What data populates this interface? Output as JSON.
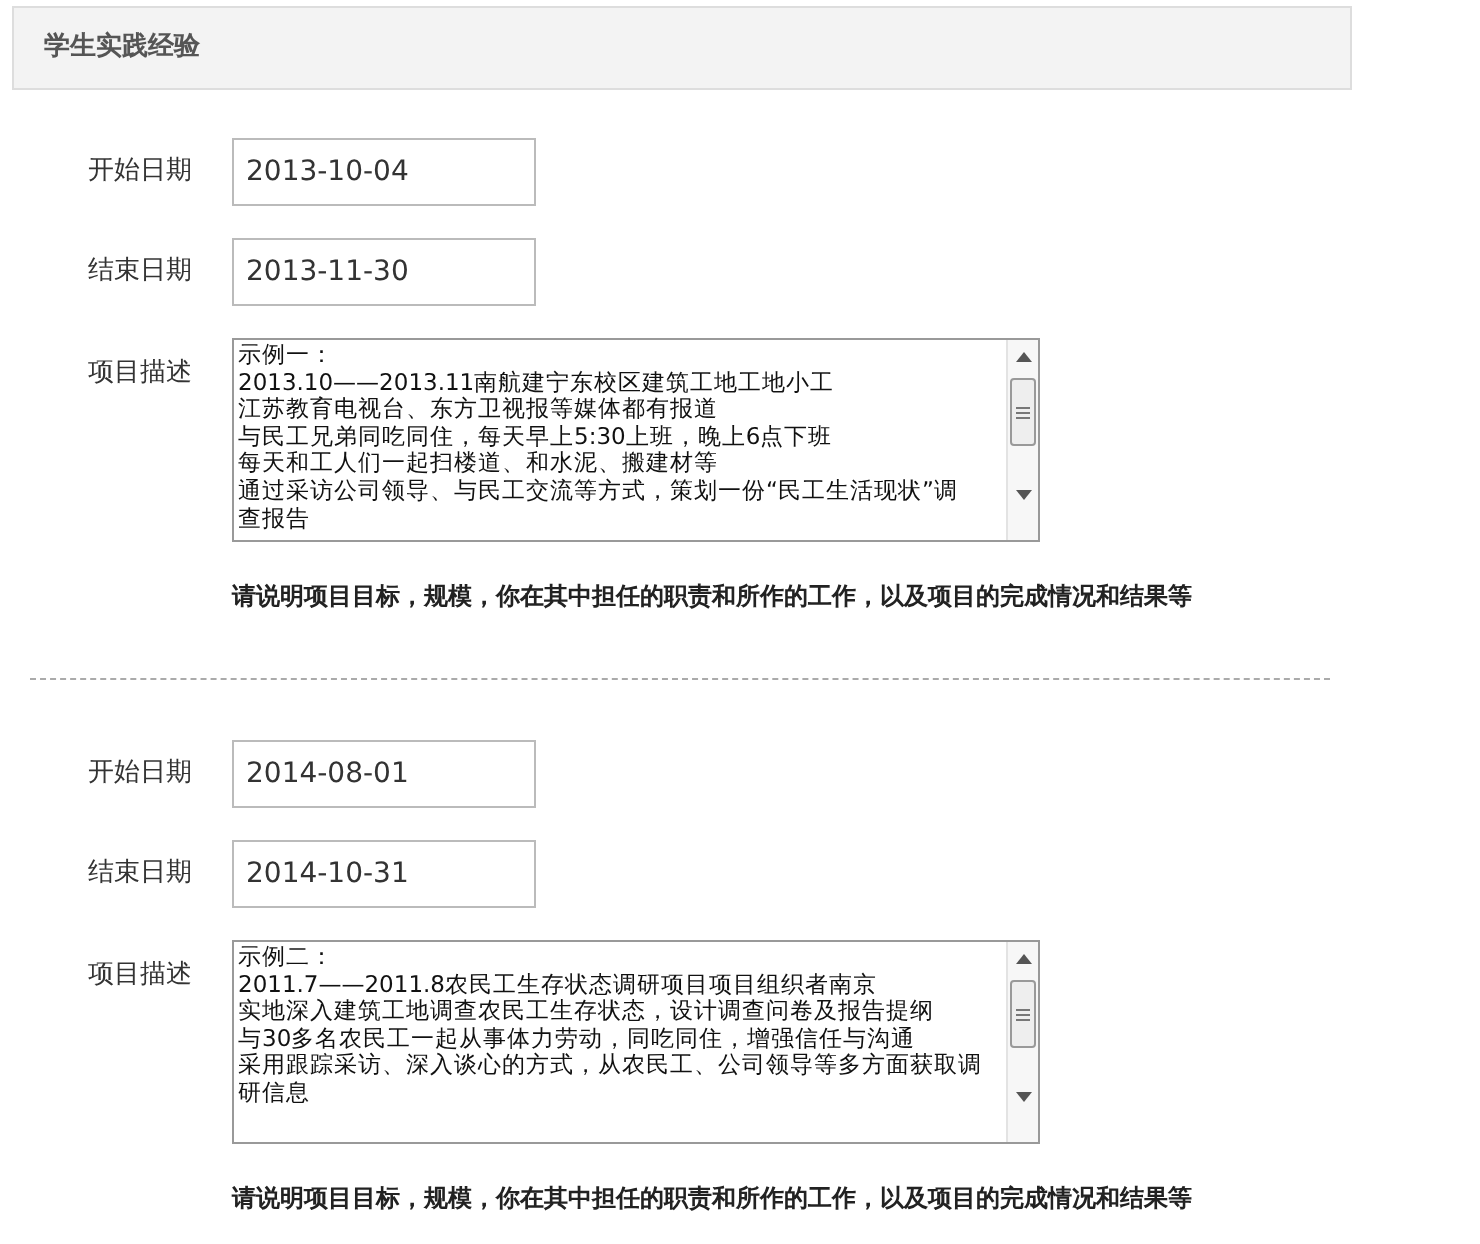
{
  "section_title": "学生实践经验",
  "entries": [
    {
      "start_label": "开始日期",
      "start_date": "2013-10-04",
      "end_label": "结束日期",
      "end_date": "2013-11-30",
      "desc_label": "项目描述",
      "description_lines": [
        "示例一：",
        "2013.10——2013.11南航建宁东校区建筑工地工地小工",
        "江苏教育电视台、东方卫视报等媒体都有报道",
        "与民工兄弟同吃同住，每天早上5:30上班，晚上6点下班",
        "每天和工人们一起扫楼道、和水泥、搬建材等",
        "通过采访公司领导、与民工交流等方式，策划一份“民工生活现状”调",
        "查报告"
      ],
      "hint": "请说明项目目标，规模，你在其中担任的职责和所作的工作，以及项目的完成情况和结果等"
    },
    {
      "start_label": "开始日期",
      "start_date": "2014-08-01",
      "end_label": "结束日期",
      "end_date": "2014-10-31",
      "desc_label": "项目描述",
      "description_lines": [
        "示例二：",
        "2011.7——2011.8农民工生存状态调研项目项目组织者南京",
        "实地深入建筑工地调查农民工生存状态，设计调查问卷及报告提纲",
        "与30多名农民工一起从事体力劳动，同吃同住，增强信任与沟通",
        "采用跟踪采访、深入谈心的方式，从农民工、公司领导等多方面获取调",
        "研信息"
      ],
      "hint": "请说明项目目标，规模，你在其中担任的职责和所作的工作，以及项目的完成情况和结果等"
    }
  ]
}
